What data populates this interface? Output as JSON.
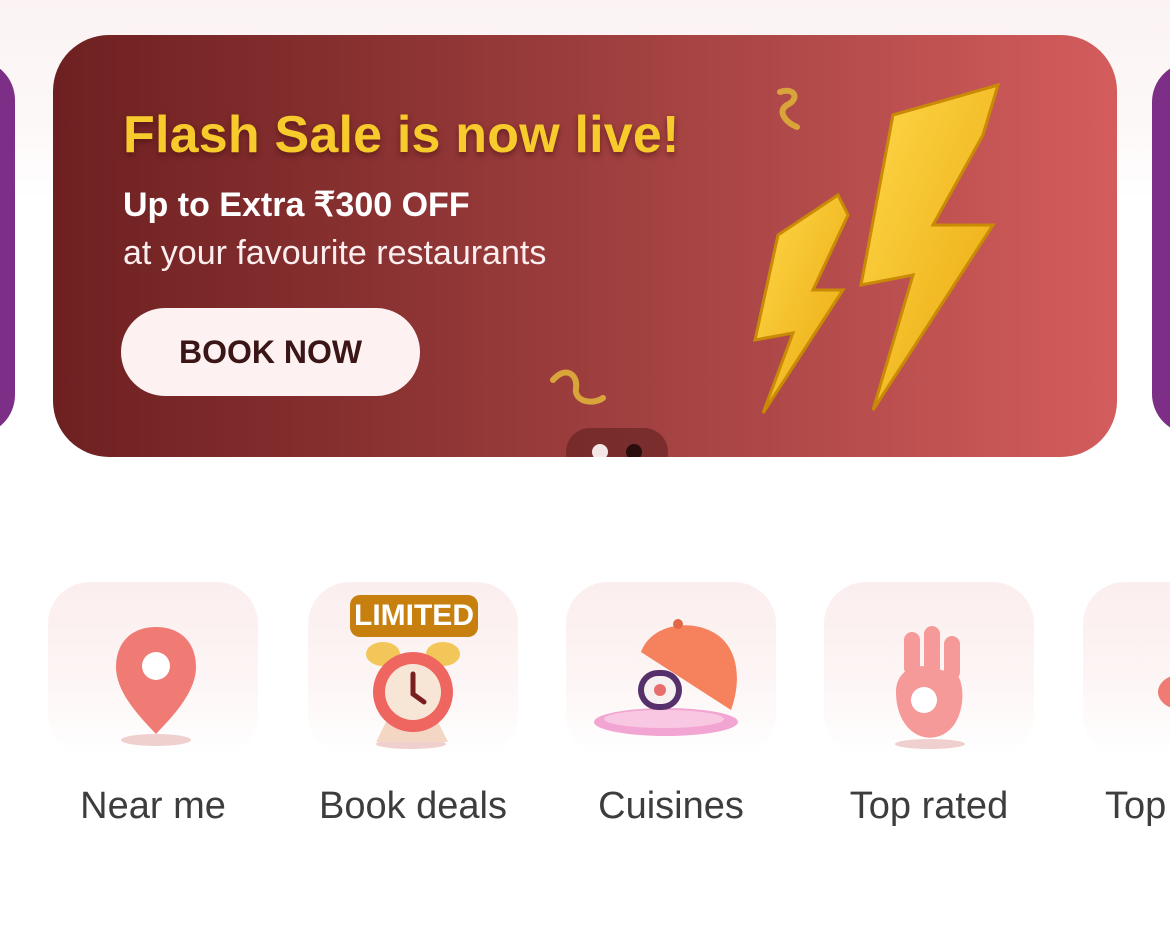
{
  "banner": {
    "title": "Flash Sale is now live!",
    "subtitle": "Up to Extra ₹300 OFF",
    "subtitle2": "at your favourite restaurants",
    "cta_label": "BOOK NOW",
    "page_indicator": {
      "active_index": 0,
      "total": 2
    },
    "colors": {
      "gradient_start": "#6e2021",
      "gradient_end": "#d45c5c",
      "title": "#f7cb2c",
      "bolt": "#f5c21a"
    }
  },
  "categories": [
    {
      "label": "Near me",
      "icon": "location-pin-icon"
    },
    {
      "label": "Book deals",
      "icon": "alarm-clock-icon",
      "badge": "LIMITED"
    },
    {
      "label": "Cuisines",
      "icon": "cloche-dish-icon"
    },
    {
      "label": "Top rated",
      "icon": "ok-hand-icon"
    },
    {
      "label": "Top",
      "icon": "category-icon"
    }
  ],
  "colors": {
    "side_card": "#7d2e86",
    "badge": "#c7800e",
    "label_text": "#3d3d3d"
  }
}
